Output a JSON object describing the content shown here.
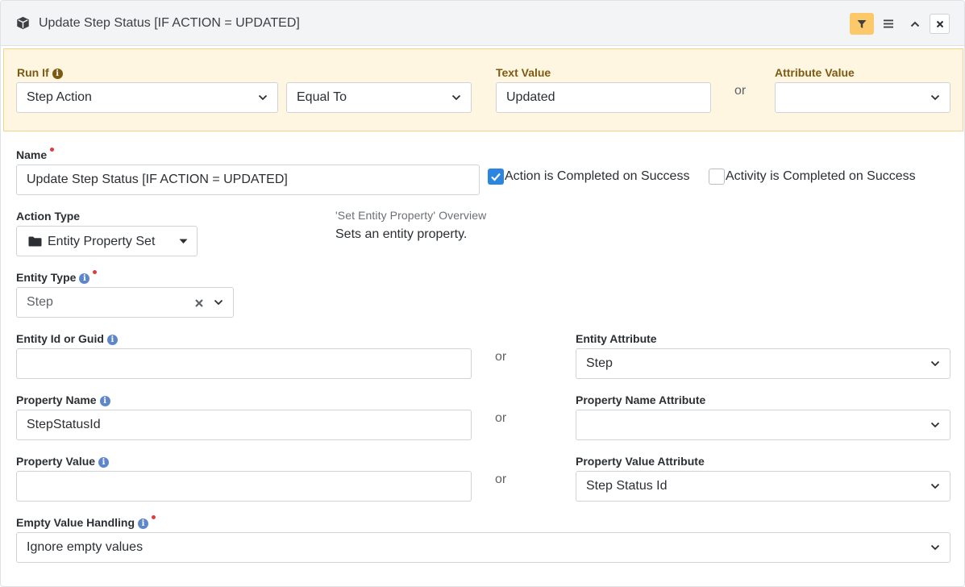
{
  "header": {
    "title": "Update Step Status [IF ACTION = UPDATED]",
    "icons": [
      "cube-icon",
      "filter-icon",
      "menu-icon",
      "chevron-up-icon",
      "close-icon"
    ]
  },
  "run_if": {
    "label": "Run If",
    "attribute": "Step Action",
    "operator": "Equal To",
    "text_value_label": "Text Value",
    "text_value": "Updated",
    "or": "or",
    "attribute_value_label": "Attribute Value",
    "attribute_value": ""
  },
  "name": {
    "label": "Name",
    "value": "Update Step Status [IF ACTION = UPDATED]",
    "action_completed_label": "Action is Completed on Success",
    "action_completed_checked": true,
    "activity_completed_label": "Activity is Completed on Success",
    "activity_completed_checked": false
  },
  "action_type": {
    "label": "Action Type",
    "value": "Entity Property Set",
    "overview_title": "'Set Entity Property' Overview",
    "overview_text": "Sets an entity property."
  },
  "entity_type": {
    "label": "Entity Type",
    "value": "Step"
  },
  "entity_id": {
    "label": "Entity Id or Guid",
    "value": "",
    "or": "or",
    "attribute_label": "Entity Attribute",
    "attribute_value": "Step"
  },
  "property_name": {
    "label": "Property Name",
    "value": "StepStatusId",
    "or": "or",
    "attribute_label": "Property Name Attribute",
    "attribute_value": ""
  },
  "property_value": {
    "label": "Property Value",
    "value": "",
    "or": "or",
    "attribute_label": "Property Value Attribute",
    "attribute_value": "Step Status Id"
  },
  "empty_value_handling": {
    "label": "Empty Value Handling",
    "value": "Ignore empty values"
  },
  "colors": {
    "accent": "#2a86e0",
    "filter_button": "#fcc96a",
    "run_if_background": "#fef6e0",
    "required": "#e03b3b"
  }
}
